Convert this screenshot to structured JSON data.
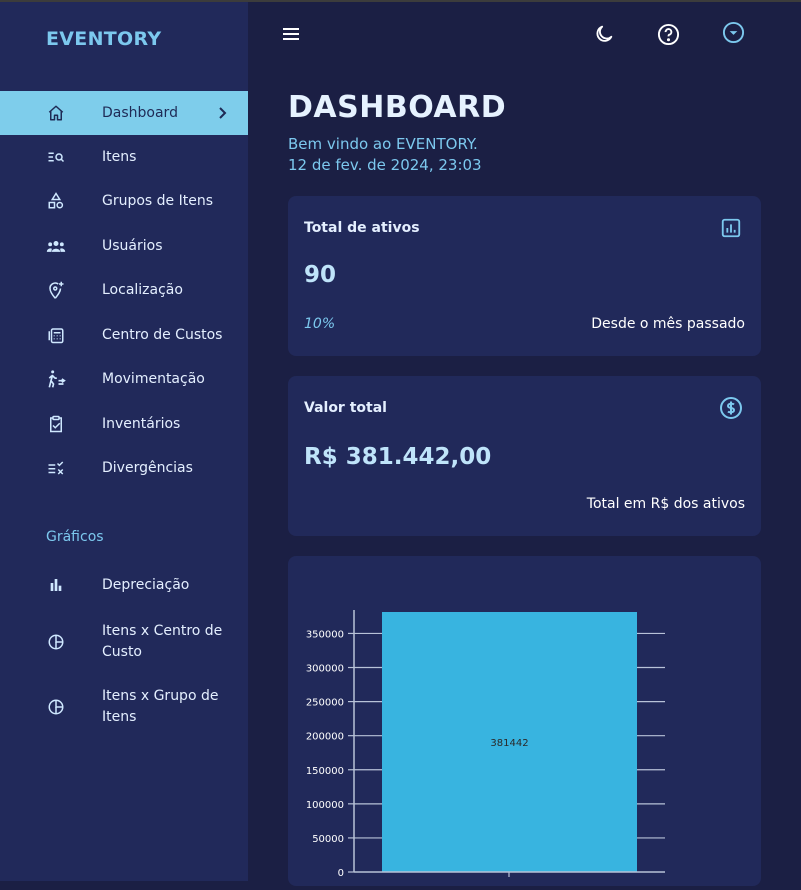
{
  "app": {
    "brand": "EVENTORY"
  },
  "sidebar": {
    "items": [
      {
        "label": "Dashboard",
        "icon": "home-icon",
        "active": true
      },
      {
        "label": "Itens",
        "icon": "list-search-icon"
      },
      {
        "label": "Grupos de Itens",
        "icon": "shapes-icon"
      },
      {
        "label": "Usuários",
        "icon": "users-icon"
      },
      {
        "label": "Localização",
        "icon": "location-add-icon"
      },
      {
        "label": "Centro de Custos",
        "icon": "calculator-icon"
      },
      {
        "label": "Movimentação",
        "icon": "walking-person-icon"
      },
      {
        "label": "Inventários",
        "icon": "clipboard-check-icon"
      },
      {
        "label": "Divergências",
        "icon": "list-x-icon"
      }
    ],
    "section_label": "Gráficos",
    "chart_items": [
      {
        "label": "Depreciação",
        "icon": "bar-chart-icon"
      },
      {
        "label_line1": "Itens x Centro de",
        "label_line2": "Custo",
        "icon": "pie-chart-icon"
      },
      {
        "label_line1": "Itens x Grupo de",
        "label_line2": "Itens",
        "icon": "pie-chart-icon"
      }
    ]
  },
  "header": {
    "icons": [
      "menu-icon",
      "moon-icon",
      "help-icon",
      "dropdown-circle-icon"
    ]
  },
  "main": {
    "title": "DASHBOARD",
    "welcome": "Bem vindo ao EVENTORY.",
    "datetime": "12 de fev. de 2024, 23:03",
    "cards": [
      {
        "title": "Total de ativos",
        "value": "90",
        "left_note": "10%",
        "right_note": "Desde o mês passado",
        "icon": "report-chart-icon"
      },
      {
        "title": "Valor total",
        "value": "R$ 381.442,00",
        "right_note": "Total em R$ dos ativos",
        "icon": "dollar-circle-icon"
      }
    ]
  },
  "colors": {
    "accent": "#7ecdeb",
    "sidebar_bg": "#21295a",
    "page_bg": "#1b1f44",
    "bar": "#38b4e0"
  },
  "chart_data": {
    "type": "bar",
    "categories": [
      ""
    ],
    "values": [
      381442
    ],
    "data_labels": [
      "381442"
    ],
    "yticks": [
      "0",
      "50000",
      "100000",
      "150000",
      "200000",
      "250000",
      "300000",
      "350000"
    ],
    "ylim": [
      0,
      381442
    ],
    "grid": true
  }
}
